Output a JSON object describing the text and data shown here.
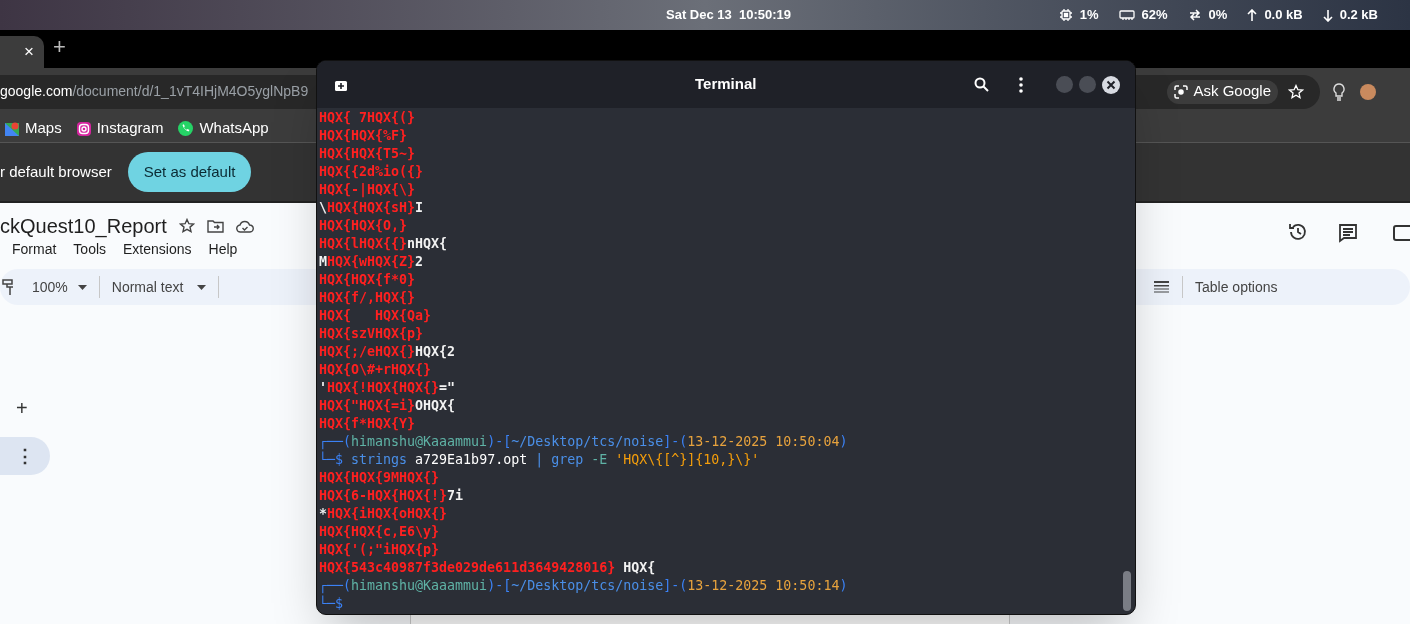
{
  "top_bar": {
    "clock": "Sat Dec 13  10:50:19",
    "stats": [
      {
        "kind": "cpu",
        "value": "1%"
      },
      {
        "kind": "memory",
        "value": "62%"
      },
      {
        "kind": "swap",
        "value": "0%"
      },
      {
        "kind": "upload",
        "value": "0.0 kB"
      },
      {
        "kind": "download",
        "value": "0.2 kB"
      }
    ]
  },
  "browser": {
    "tab_close": "×",
    "new_tab": "+",
    "url_host": "google.com",
    "url_path": "/document/d/1_1vT4IHjM4O5yglNpB9",
    "ask_google": "Ask Google",
    "bookmarks": [
      {
        "kind": "maps",
        "label": "Maps"
      },
      {
        "kind": "instagram",
        "label": "Instagram"
      },
      {
        "kind": "whatsapp",
        "label": "WhatsApp"
      }
    ],
    "infobar": {
      "message": "r default browser",
      "button": "Set as default"
    },
    "doc": {
      "title": "ckQuest10_Report",
      "menu": [
        "Format",
        "Tools",
        "Extensions",
        "Help"
      ],
      "zoom": "100%",
      "style": "Normal text",
      "table_options": "Table options",
      "add": "+",
      "more": "⋮"
    }
  },
  "terminal": {
    "title": "Terminal",
    "lines": [
      {
        "kind": "output",
        "segments": [
          {
            "color": "#ff2020",
            "text": "HQX{ 7HQX{(}"
          }
        ]
      },
      {
        "kind": "output",
        "segments": [
          {
            "color": "#ff2020",
            "text": "HQX{HQX{%F}"
          }
        ]
      },
      {
        "kind": "output",
        "segments": [
          {
            "color": "#ff2020",
            "text": "HQX{HQX{T5~}"
          }
        ]
      },
      {
        "kind": "output",
        "segments": [
          {
            "color": "#ff2020",
            "text": "HQX{{2d%io({}"
          }
        ]
      },
      {
        "kind": "output",
        "segments": [
          {
            "color": "#ff2020",
            "text": "HQX{-|HQX{\\}"
          }
        ]
      },
      {
        "kind": "output",
        "segments": [
          {
            "text": "\\"
          },
          {
            "color": "#ff2020",
            "text": "HQX{HQX{sH}"
          },
          {
            "text": "I"
          }
        ]
      },
      {
        "kind": "output",
        "segments": [
          {
            "color": "#ff2020",
            "text": "HQX{HQX{O,}"
          }
        ]
      },
      {
        "kind": "output",
        "segments": [
          {
            "color": "#ff2020",
            "text": "HQX{lHQX{{}"
          },
          {
            "text": "nHQX{"
          }
        ]
      },
      {
        "kind": "output",
        "segments": [
          {
            "text": "M"
          },
          {
            "color": "#ff2020",
            "text": "HQX{wHQX{Z}"
          },
          {
            "text": "2"
          }
        ]
      },
      {
        "kind": "output",
        "segments": [
          {
            "color": "#ff2020",
            "text": "HQX{HQX{f*0}"
          }
        ]
      },
      {
        "kind": "output",
        "segments": [
          {
            "color": "#ff2020",
            "text": "HQX{f/,HQX{}"
          }
        ]
      },
      {
        "kind": "output",
        "segments": [
          {
            "color": "#ff2020",
            "text": "HQX{   HQX{Qa}"
          }
        ]
      },
      {
        "kind": "output",
        "segments": [
          {
            "color": "#ff2020",
            "text": "HQX{szVHQX{p}"
          }
        ]
      },
      {
        "kind": "output",
        "segments": [
          {
            "color": "#ff2020",
            "text": "HQX{;/eHQX{}"
          },
          {
            "text": "HQX{2"
          }
        ]
      },
      {
        "kind": "output",
        "segments": [
          {
            "color": "#ff2020",
            "text": "HQX{O\\#+rHQX{}"
          }
        ]
      },
      {
        "kind": "output",
        "segments": [
          {
            "text": "'"
          },
          {
            "color": "#ff2020",
            "text": "HQX{!HQX{HQX{}"
          },
          {
            "text": "=\""
          }
        ]
      },
      {
        "kind": "output",
        "segments": [
          {
            "color": "#ff2020",
            "text": "HQX{\"HQX{=i}"
          },
          {
            "text": "OHQX{"
          }
        ]
      },
      {
        "kind": "output",
        "segments": [
          {
            "color": "#ff2020",
            "text": "HQX{f*HQX{Y}"
          }
        ]
      },
      {
        "kind": "prompt",
        "segments": [
          {
            "text": "┌──("
          },
          {
            "color": "#5fb3a6",
            "text": "himanshu@Kaaammui"
          },
          {
            "text": ")-["
          },
          {
            "color": "#4a8fe8",
            "text": "~/Desktop/tcs/noise"
          },
          {
            "text": "]-("
          },
          {
            "color": "#e8a33d",
            "text": "13-12-2025 10:50:04"
          },
          {
            "text": ")"
          }
        ]
      },
      {
        "kind": "command",
        "segments": [
          {
            "text": "└─$ "
          },
          {
            "color": "#4a8fe8",
            "text": "strings"
          },
          {
            "color": "#ffffff",
            "text": " a729Ea1b97.opt"
          },
          {
            "color": "#4a8fe8",
            "text": " | grep"
          },
          {
            "color": "#5fb3a6",
            "text": " -E "
          },
          {
            "color": "#f59e0b",
            "text": "'HQX\\{[^}]{10,}\\}'"
          }
        ]
      },
      {
        "kind": "output",
        "segments": [
          {
            "color": "#ff2020",
            "text": "HQX{HQX{9MHQX{}"
          }
        ]
      },
      {
        "kind": "output",
        "segments": [
          {
            "color": "#ff2020",
            "text": "HQX{6-HQX{HQX{!}"
          },
          {
            "text": "7i"
          }
        ]
      },
      {
        "kind": "output",
        "segments": [
          {
            "text": "*"
          },
          {
            "color": "#ff2020",
            "text": "HQX{iHQX{oHQX{}"
          }
        ]
      },
      {
        "kind": "output",
        "segments": [
          {
            "color": "#ff2020",
            "text": "HQX{HQX{c,E6\\y}"
          }
        ]
      },
      {
        "kind": "output",
        "segments": [
          {
            "color": "#ff2020",
            "text": "HQX{'(;\"iHQX{p}"
          }
        ]
      },
      {
        "kind": "output",
        "segments": [
          {
            "color": "#ff2020",
            "text": "HQX{543c40987f3de029de611d3649428016}"
          },
          {
            "text": " HQX{"
          }
        ]
      },
      {
        "kind": "prompt",
        "segments": [
          {
            "text": "┌──("
          },
          {
            "color": "#5fb3a6",
            "text": "himanshu@Kaaammui"
          },
          {
            "text": ")-["
          },
          {
            "color": "#4a8fe8",
            "text": "~/Desktop/tcs/noise"
          },
          {
            "text": "]-("
          },
          {
            "color": "#e8a33d",
            "text": "13-12-2025 10:50:14"
          },
          {
            "text": ")"
          }
        ]
      },
      {
        "kind": "command",
        "segments": [
          {
            "text": "└─$"
          }
        ]
      }
    ]
  }
}
